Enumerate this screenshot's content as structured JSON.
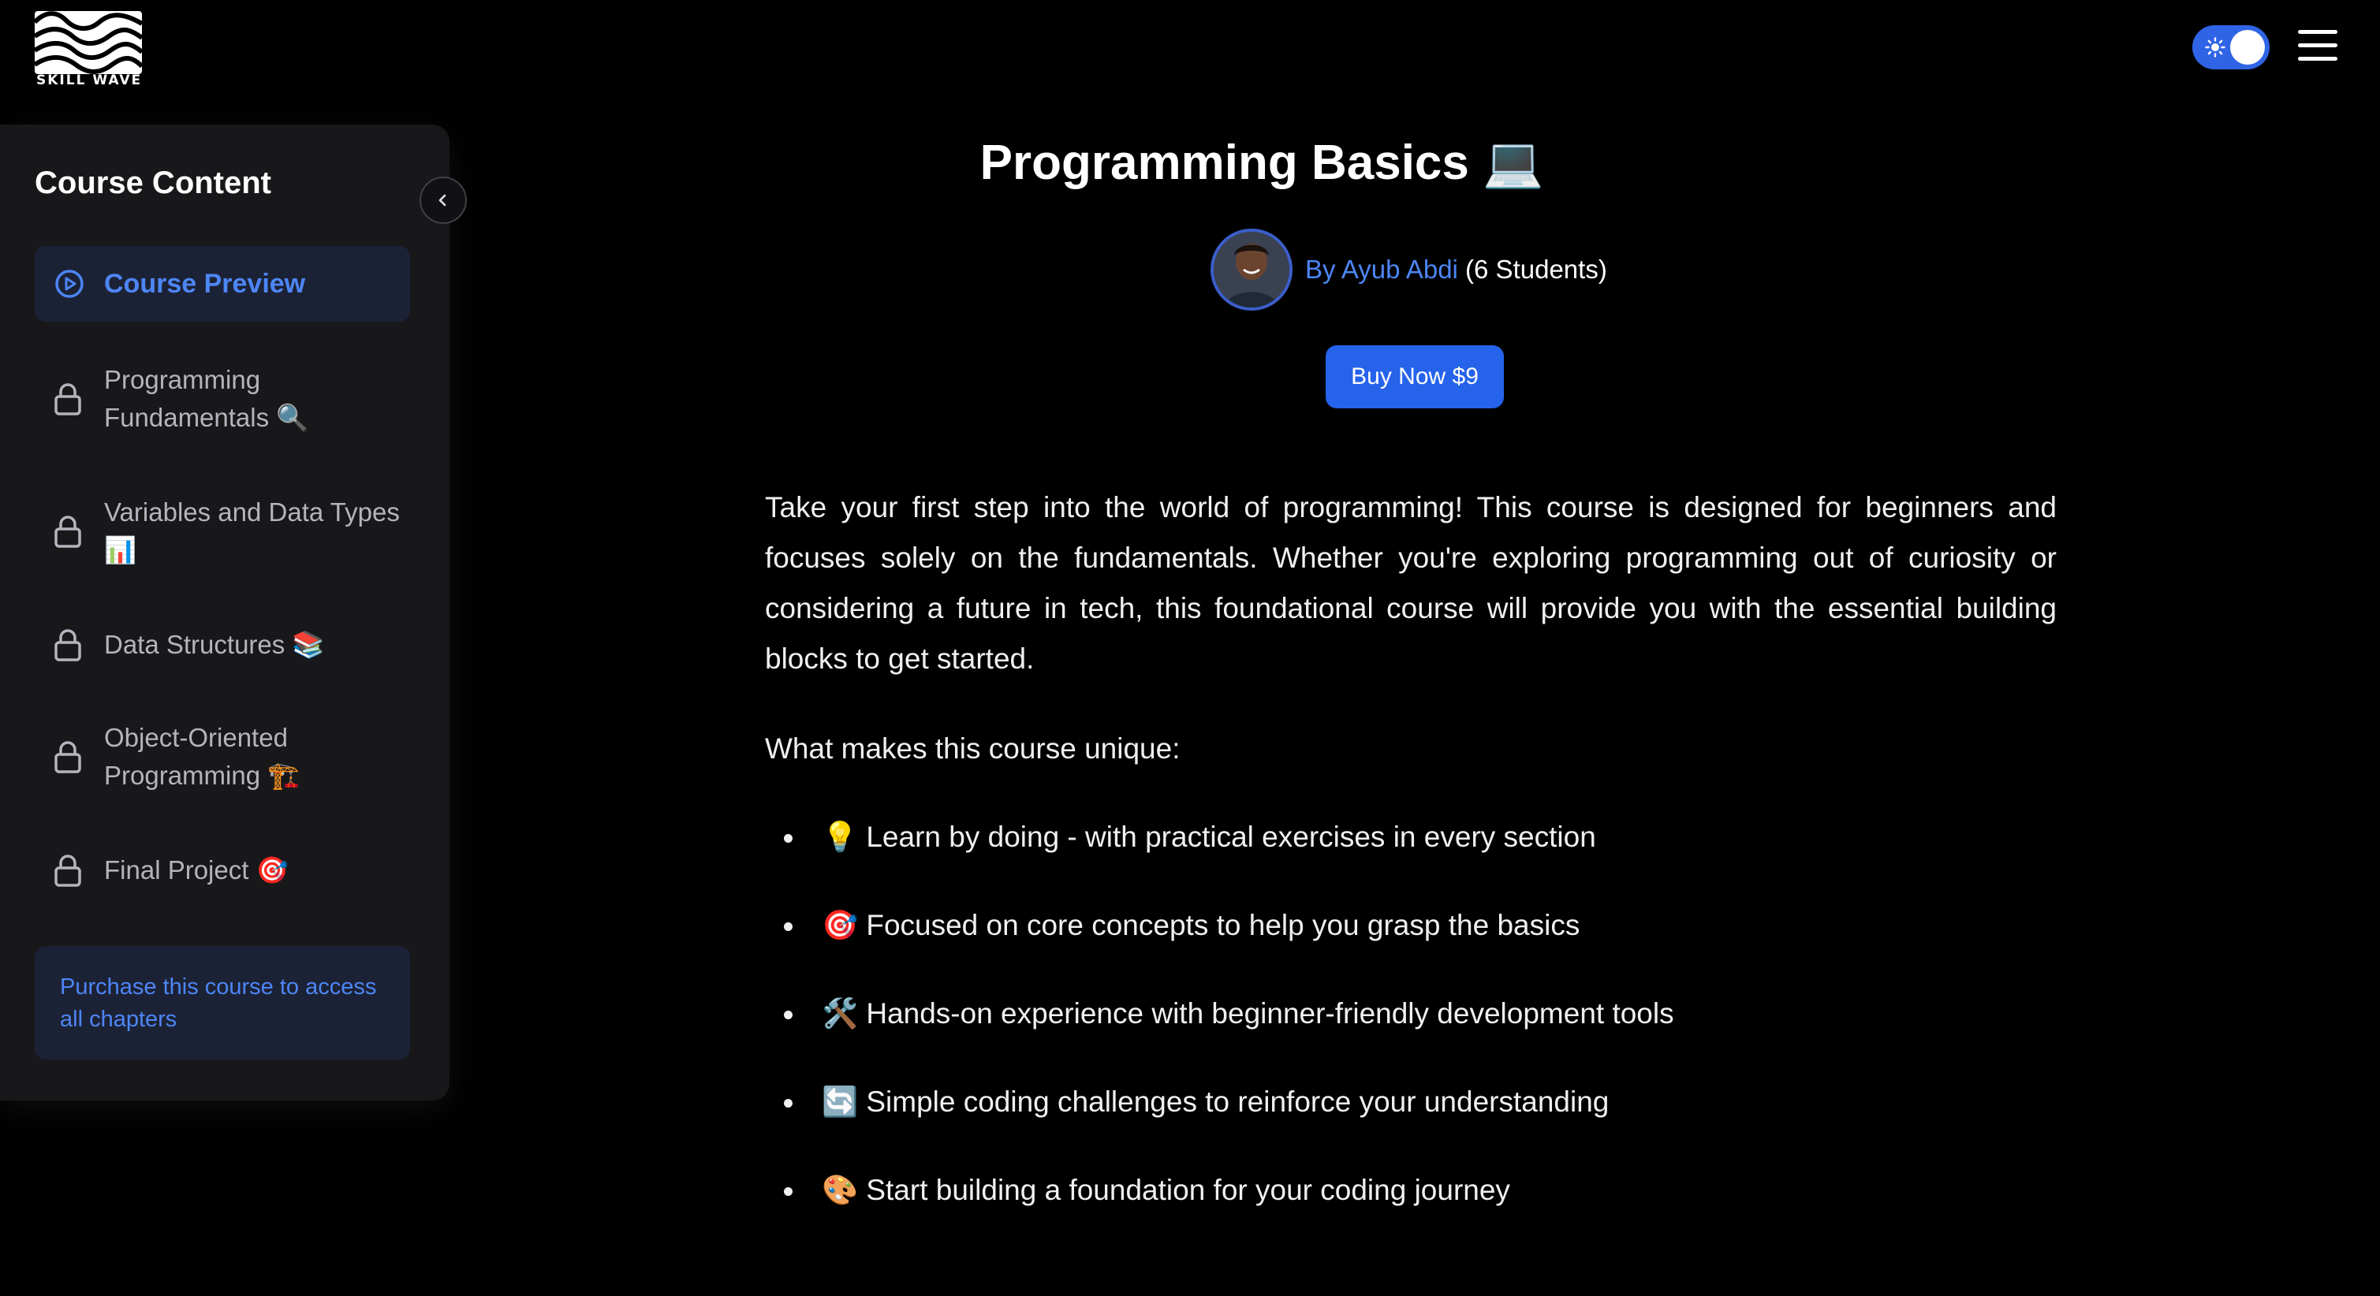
{
  "brand": {
    "logo_text": "SKILL WAVE"
  },
  "header": {
    "theme_toggle_icon": "sun-icon",
    "menu_icon": "hamburger-menu-icon"
  },
  "sidebar": {
    "title": "Course Content",
    "collapse_icon": "chevron-left-icon",
    "chapters": [
      {
        "label": "Course Preview",
        "icon": "play-circle-icon",
        "active": true
      },
      {
        "label": "Programming Fundamentals 🔍",
        "icon": "lock-icon",
        "active": false
      },
      {
        "label": "Variables and Data Types 📊",
        "icon": "lock-icon",
        "active": false
      },
      {
        "label": "Data Structures 📚",
        "icon": "lock-icon",
        "active": false
      },
      {
        "label": "Object-Oriented Programming 🏗️",
        "icon": "lock-icon",
        "active": false
      },
      {
        "label": "Final Project 🎯",
        "icon": "lock-icon",
        "active": false
      }
    ],
    "purchase_note": "Purchase this course to access all chapters"
  },
  "course": {
    "title": "Programming Basics 💻",
    "author_link": "By Ayub Abdi",
    "students": "(6 Students)",
    "buy_button": "Buy Now $9",
    "description": "Take your first step into the world of programming! This course is designed for beginners and focuses solely on the fundamentals. Whether you're exploring programming out of curiosity or considering a future in tech, this foundational course will provide you with the essential building blocks to get started.",
    "unique_heading": "What makes this course unique:",
    "features": [
      "💡 Learn by doing - with practical exercises in every section",
      "🎯 Focused on core concepts to help you grasp the basics",
      "🛠️ Hands-on experience with beginner-friendly development tools",
      "🔄 Simple coding challenges to reinforce your understanding",
      "🎨 Start building a foundation for your coding journey"
    ]
  },
  "colors": {
    "background": "#000000",
    "sidebar": "#18181b",
    "accent": "#2563eb",
    "link": "#4d86f5",
    "active_item_bg": "#1c2236"
  }
}
